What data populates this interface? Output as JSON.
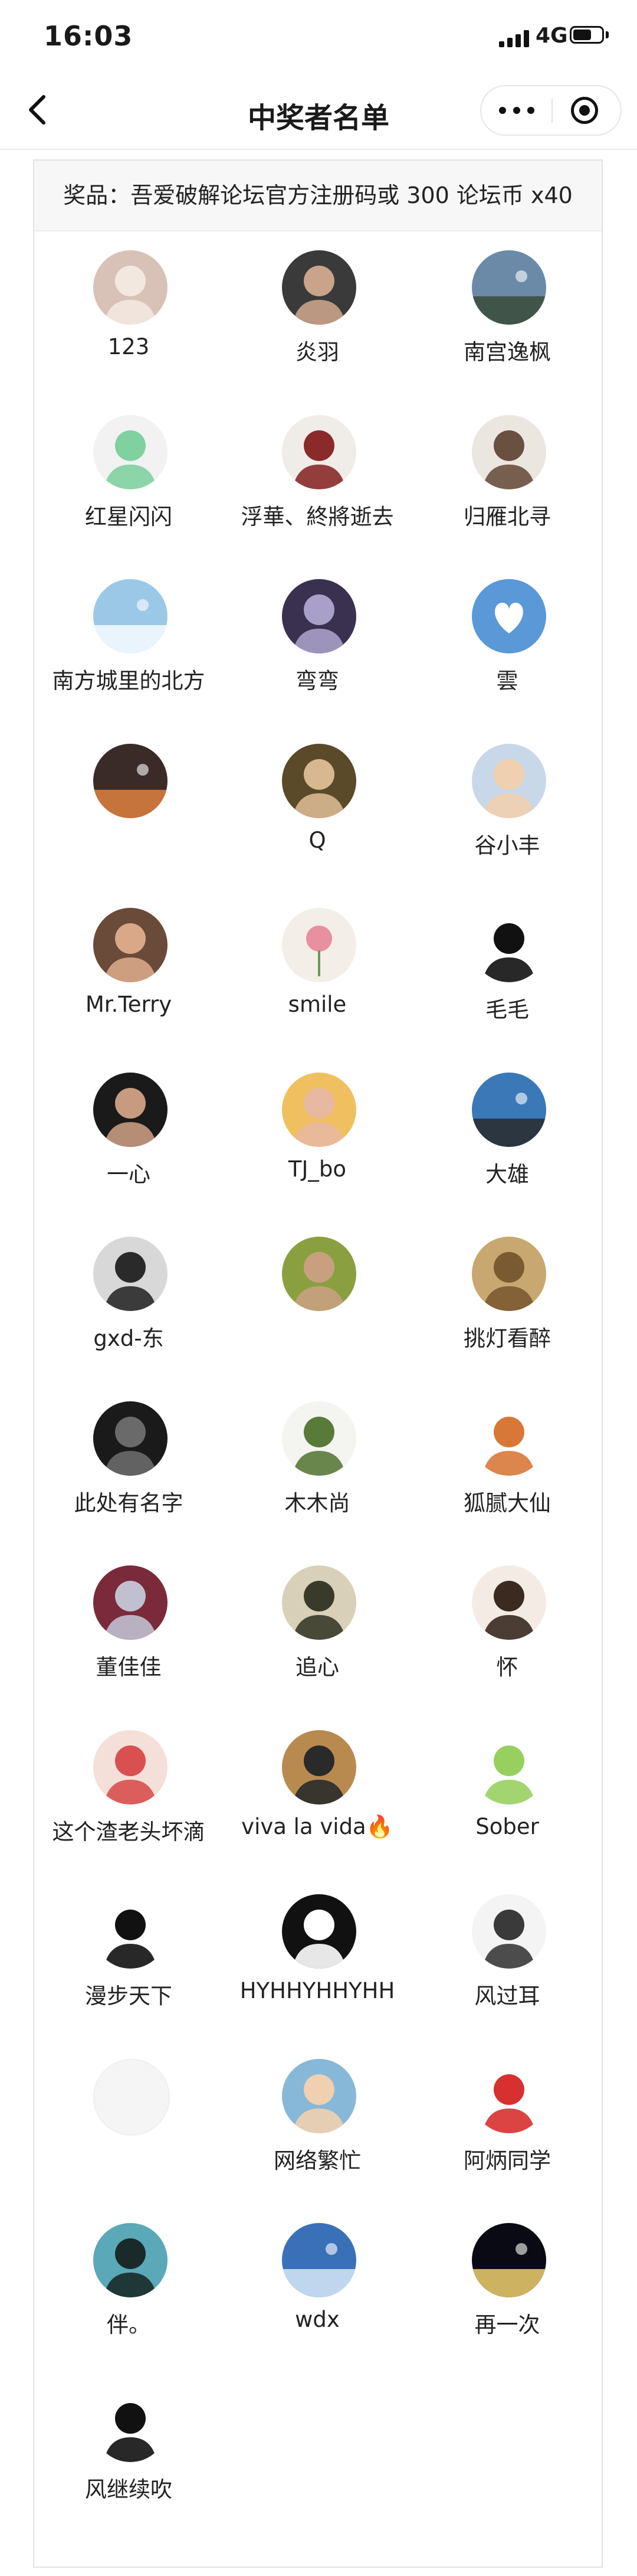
{
  "status": {
    "time": "16:03",
    "network": "4G"
  },
  "nav": {
    "title": "中奖者名单"
  },
  "prize": "奖品：吾爱破解论坛官方注册码或 300 论坛币 x40",
  "colors": {
    "accent": "#111111",
    "panel_border": "#e4e4e4",
    "prize_bg": "#f7f7f7"
  },
  "winners": [
    {
      "name": "123",
      "avatar": {
        "bg": "#d8c2b8",
        "fg": "#f3e8e0",
        "icon": "pig-avatar"
      }
    },
    {
      "name": "炎羽",
      "avatar": {
        "bg": "#3a3a3a",
        "fg": "#c9a38a",
        "icon": "person-avatar"
      }
    },
    {
      "name": "南宫逸枫",
      "avatar": {
        "bg": "#6a8aa8",
        "fg": "#3a4a3a",
        "icon": "landscape-avatar"
      }
    },
    {
      "name": "红星闪闪",
      "avatar": {
        "bg": "#f2f2f2",
        "fg": "#7fd1a0",
        "icon": "bunny-avatar"
      }
    },
    {
      "name": "浮華、終將逝去",
      "avatar": {
        "bg": "#f0ece8",
        "fg": "#8a2a2a",
        "icon": "anime-avatar"
      }
    },
    {
      "name": "归雁北寻",
      "avatar": {
        "bg": "#ece6e0",
        "fg": "#6a5040",
        "icon": "anime-girl-avatar"
      }
    },
    {
      "name": "南方城里的北方",
      "avatar": {
        "bg": "#9cc8e8",
        "fg": "#f8fbff",
        "icon": "sky-avatar"
      }
    },
    {
      "name": "弯弯",
      "avatar": {
        "bg": "#3a3050",
        "fg": "#a8a0c8",
        "icon": "anime-avatar"
      }
    },
    {
      "name": "雲",
      "avatar": {
        "bg": "#5a98d8",
        "fg": "#ffffff",
        "icon": "heart-cloud-avatar"
      }
    },
    {
      "name": "",
      "avatar": {
        "bg": "#3a2a28",
        "fg": "#e08040",
        "icon": "sunset-avatar"
      }
    },
    {
      "name": "Q",
      "avatar": {
        "bg": "#5a4a2a",
        "fg": "#d8b890",
        "icon": "person-avatar"
      }
    },
    {
      "name": "谷小丰",
      "avatar": {
        "bg": "#c8d8e8",
        "fg": "#f0d0b0",
        "icon": "baby-avatar"
      }
    },
    {
      "name": "Mr.Terry",
      "avatar": {
        "bg": "#6a4a38",
        "fg": "#d8a888",
        "icon": "couple-avatar"
      }
    },
    {
      "name": "smile",
      "avatar": {
        "bg": "#f4eee8",
        "fg": "#e890a0",
        "icon": "flower-avatar"
      }
    },
    {
      "name": "毛毛",
      "avatar": {
        "bg": "#ffffff",
        "fg": "#111111",
        "icon": "meme-face-avatar"
      }
    },
    {
      "name": "一心",
      "avatar": {
        "bg": "#1a1a1a",
        "fg": "#c89a80",
        "icon": "person-avatar"
      }
    },
    {
      "name": "TJ_bo",
      "avatar": {
        "bg": "#f0c060",
        "fg": "#e8b8a0",
        "icon": "glasses-avatar"
      }
    },
    {
      "name": "大雄",
      "avatar": {
        "bg": "#3a78b8",
        "fg": "#2a2a2a",
        "icon": "beach-avatar"
      }
    },
    {
      "name": "gxd-东",
      "avatar": {
        "bg": "#d8d8d8",
        "fg": "#2a2a2a",
        "icon": "person-avatar"
      }
    },
    {
      "name": "",
      "avatar": {
        "bg": "#8aa040",
        "fg": "#c8a080",
        "icon": "cartoon-avatar"
      }
    },
    {
      "name": "挑灯看醉",
      "avatar": {
        "bg": "#c8a870",
        "fg": "#7a5a30",
        "icon": "portrait-avatar"
      }
    },
    {
      "name": "此处有名字",
      "avatar": {
        "bg": "#1a1a1a",
        "fg": "#6a6a6a",
        "icon": "person-avatar"
      }
    },
    {
      "name": "木木尚",
      "avatar": {
        "bg": "#f4f4f0",
        "fg": "#5a7a3a",
        "icon": "cartoon-avatar"
      }
    },
    {
      "name": "狐腻大仙",
      "avatar": {
        "bg": "#ffffff",
        "fg": "#d87838",
        "icon": "fox-avatar"
      }
    },
    {
      "name": "董佳佳",
      "avatar": {
        "bg": "#7a2a3a",
        "fg": "#c0c0d0",
        "icon": "ultraman-avatar"
      }
    },
    {
      "name": "追心",
      "avatar": {
        "bg": "#d8d0b8",
        "fg": "#3a3a2a",
        "icon": "calligraphy-avatar"
      }
    },
    {
      "name": "怀",
      "avatar": {
        "bg": "#f4ece4",
        "fg": "#3a2a20",
        "icon": "cartoon-boy-avatar"
      }
    },
    {
      "name": "这个渣老头坏滴",
      "avatar": {
        "bg": "#f4e0d8",
        "fg": "#d85050",
        "icon": "cartoon-avatar"
      }
    },
    {
      "name": "viva la vida🔥",
      "avatar": {
        "bg": "#b88a50",
        "fg": "#2a2a2a",
        "icon": "person-avatar"
      }
    },
    {
      "name": "Sober",
      "avatar": {
        "bg": "#ffffff",
        "fg": "#98d060",
        "icon": "dino-avatar"
      }
    },
    {
      "name": "漫步天下",
      "avatar": {
        "bg": "#ffffff",
        "fg": "#111111",
        "icon": "panda-meme-avatar"
      }
    },
    {
      "name": "HYHHYHHYHH",
      "avatar": {
        "bg": "#111111",
        "fg": "#ffffff",
        "icon": "text-meme-avatar"
      }
    },
    {
      "name": "风过耳",
      "avatar": {
        "bg": "#f4f4f4",
        "fg": "#3a3a3a",
        "icon": "sketch-boy-avatar"
      }
    },
    {
      "name": "",
      "avatar": {
        "bg": "#f5f5f5",
        "fg": "#f5f5f5",
        "icon": "blank-avatar"
      }
    },
    {
      "name": "网络繁忙",
      "avatar": {
        "bg": "#88b8d8",
        "fg": "#f0d0b0",
        "icon": "baby-avatar"
      }
    },
    {
      "name": "阿炳同学",
      "avatar": {
        "bg": "#ffffff",
        "fg": "#d83030",
        "icon": "santa-avatar"
      }
    },
    {
      "name": "伴。",
      "avatar": {
        "bg": "#5aa8b8",
        "fg": "#1a2a2a",
        "icon": "silhouette-avatar"
      }
    },
    {
      "name": "wdx",
      "avatar": {
        "bg": "#3a70b8",
        "fg": "#d8e8f8",
        "icon": "road-avatar"
      }
    },
    {
      "name": "再一次",
      "avatar": {
        "bg": "#0a0a14",
        "fg": "#f0d070",
        "icon": "night-road-avatar"
      }
    },
    {
      "name": "风继续吹",
      "avatar": {
        "bg": "#ffffff",
        "fg": "#111111",
        "icon": "panda-avatar"
      }
    }
  ]
}
